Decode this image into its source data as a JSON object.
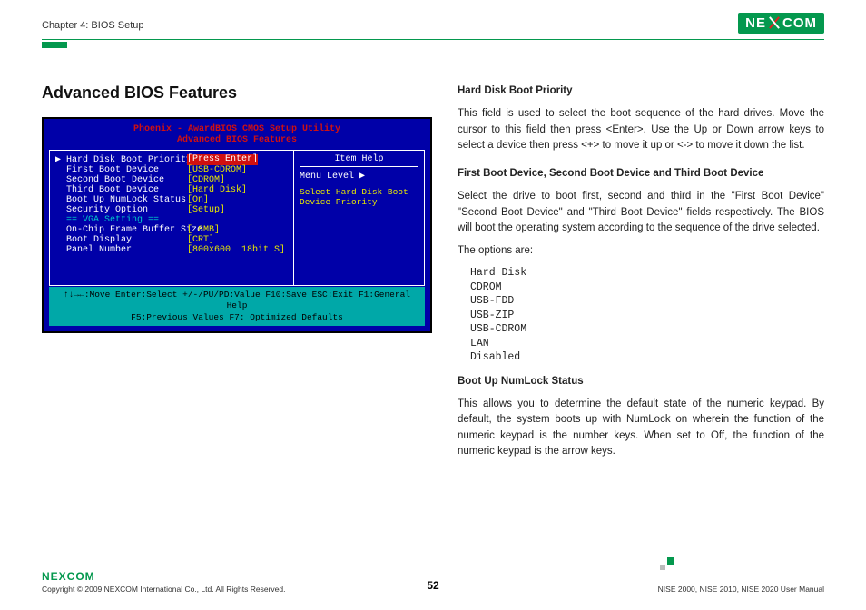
{
  "header": {
    "chapter": "Chapter 4: BIOS Setup",
    "logo_text_1": "NE",
    "logo_text_2": "COM"
  },
  "page_title": "Advanced BIOS Features",
  "bios": {
    "title_line1": "Phoenix - AwardBIOS CMOS Setup Utility",
    "title_line2": "Advanced BIOS Features",
    "rows": [
      {
        "label": "▶ Hard Disk Boot Priority",
        "value": "[Press Enter]",
        "sel": true
      },
      {
        "label": "  First Boot Device",
        "value": "[USB-CDROM]"
      },
      {
        "label": "  Second Boot Device",
        "value": "[CDROM]"
      },
      {
        "label": "  Third Boot Device",
        "value": "[Hard Disk]"
      },
      {
        "label": "  Boot Up NumLock Status",
        "value": "[On]"
      },
      {
        "label": "  Security Option",
        "value": "[Setup]"
      },
      {
        "label": "  == VGA Setting ==",
        "value": "",
        "vga": true
      },
      {
        "label": "  On-Chip Frame Buffer Size",
        "value": "[ 8MB]"
      },
      {
        "label": "  Boot Display",
        "value": "[CRT]"
      },
      {
        "label": "  Panel Number",
        "value": "[800x600  18bit S]"
      }
    ],
    "help_title": "Item Help",
    "menu_level": "Menu Level   ▶",
    "help_text": "Select Hard Disk Boot Device Priority",
    "footer_line1": "↑↓→←:Move  Enter:Select  +/-/PU/PD:Value  F10:Save  ESC:Exit  F1:General Help",
    "footer_line2": "F5:Previous Values               F7: Optimized Defaults"
  },
  "content": {
    "s1_head": "Hard Disk Boot Priority",
    "s1_body": "This field is used to select the boot sequence of the hard drives. Move the cursor to this field then press <Enter>. Use the Up or Down arrow keys to select a device then press <+> to move it up or <-> to move it down the list.",
    "s2_head": "First Boot Device, Second Boot Device and Third Boot Device",
    "s2_body": "Select the drive to boot first, second and third in the \"First Boot Device\" \"Second Boot Device\" and \"Third Boot Device\" fields respectively. The BIOS will boot the operating system according to the sequence of the drive selected.",
    "options_intro": "The options are:",
    "options": [
      "Hard Disk",
      "CDROM",
      "USB-FDD",
      "USB-ZIP",
      "USB-CDROM",
      "LAN",
      "Disabled"
    ],
    "s3_head": "Boot Up NumLock Status",
    "s3_body": "This allows you to determine the default state of the numeric keypad. By default, the system boots up with NumLock on wherein the function of the numeric keypad is the number keys. When set to Off, the function of the numeric keypad is the arrow keys."
  },
  "footer": {
    "logo": "NEXCOM",
    "copyright": "Copyright © 2009 NEXCOM International Co., Ltd. All Rights Reserved.",
    "page": "52",
    "manual": "NISE 2000, NISE 2010, NISE 2020 User Manual"
  }
}
